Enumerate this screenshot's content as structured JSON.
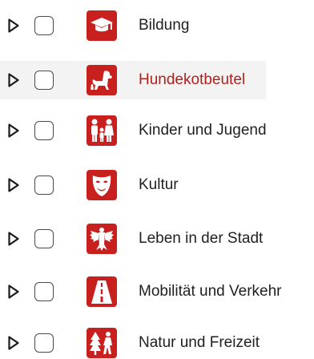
{
  "accent_color": "#c8201e",
  "hover_text_color": "#b2201c",
  "hovered_item_index": 1,
  "categories": [
    {
      "label": "Bildung",
      "icon": "graduation-cap-icon",
      "checked": false,
      "expanded": false
    },
    {
      "label": "Hundekotbeutel",
      "icon": "dog-icon",
      "checked": false,
      "expanded": false
    },
    {
      "label": "Kinder und Jugend",
      "icon": "family-icon",
      "checked": false,
      "expanded": false
    },
    {
      "label": "Kultur",
      "icon": "theater-mask-icon",
      "checked": false,
      "expanded": false
    },
    {
      "label": "Leben in der Stadt",
      "icon": "city-eagle-icon",
      "checked": false,
      "expanded": false
    },
    {
      "label": "Mobilität und Verkehr",
      "icon": "road-icon",
      "checked": false,
      "expanded": false
    },
    {
      "label": "Natur und Freizeit",
      "icon": "tree-hiker-icon",
      "checked": false,
      "expanded": false
    }
  ]
}
